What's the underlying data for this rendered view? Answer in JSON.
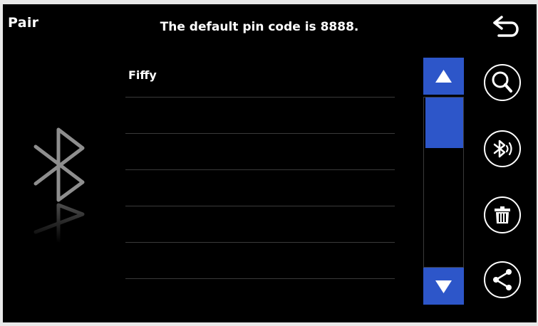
{
  "header": {
    "title": "Pair",
    "pin_message": "The default pin code is 8888."
  },
  "devices": {
    "rows": [
      "Fiffy",
      "",
      "",
      "",
      "",
      ""
    ]
  },
  "icons": {
    "back": "back-arrow-icon",
    "bluetooth": "bluetooth-icon",
    "scroll_up": "triangle-up-icon",
    "scroll_down": "triangle-down-icon",
    "search": "search-icon",
    "bluetooth_audio": "bluetooth-audio-icon",
    "delete": "trash-icon",
    "share": "share-icon"
  },
  "colors": {
    "background": "#000000",
    "accent": "#2d56c9",
    "text": "#ffffff",
    "divider": "#3a3a3a"
  }
}
